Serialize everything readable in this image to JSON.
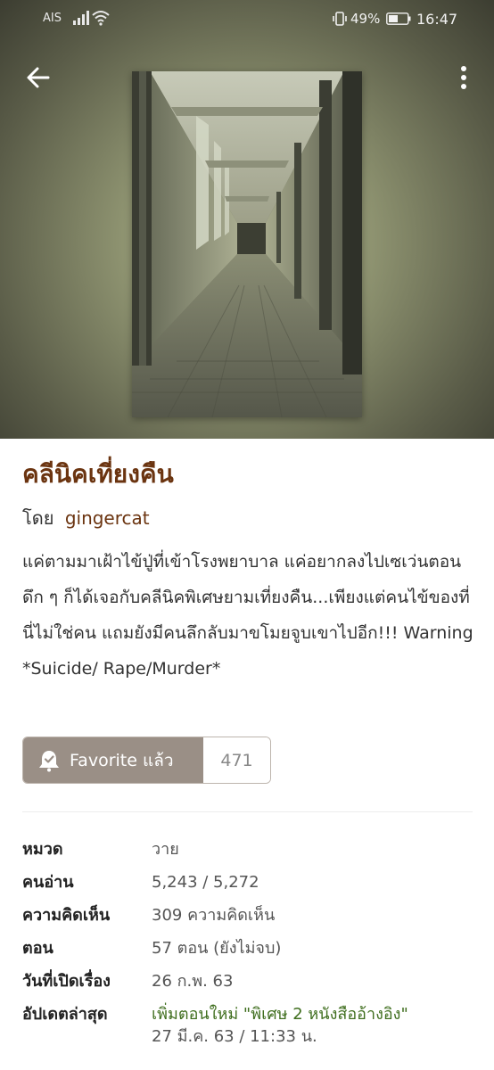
{
  "status_bar": {
    "carrier": "AIS",
    "battery_percent": "49%",
    "time": "16:47"
  },
  "icons": {
    "back": "back-arrow-icon",
    "more": "more-vertical-icon",
    "favorite": "bookmark-check-icon"
  },
  "colors": {
    "title": "#6b3410",
    "author": "#6b3410",
    "favorite_button": "#9a8f86",
    "latest_update": "#3f6e1e"
  },
  "story": {
    "title": "คลีนิคเที่ยงคืน",
    "author_prefix": "โดย",
    "author_name": "gingercat",
    "synopsis": "แค่ตามมาเฝ้าไข้ปู่ที่เข้าโรงพยาบาล แค่อยากลงไปเซเว่นตอนดึก ๆ ก็ได้เจอกับคลีนิคพิเศษยามเที่ยงคืน...เพียงแต่คนไข้ของที่นี่ไม่ใช่คน แถมยังมีคนลึกลับมาขโมยจูบเขาไปอีก!!! Warning *Suicide/ Rape/Murder*"
  },
  "favorite": {
    "label": "Favorite แล้ว",
    "count": "471"
  },
  "details": {
    "category_label": "หมวด",
    "category_value": "วาย",
    "readers_label": "คนอ่าน",
    "readers_value": "5,243 / 5,272",
    "comments_label": "ความคิดเห็น",
    "comments_value": "309 ความคิดเห็น",
    "chapters_label": "ตอน",
    "chapters_value": "57 ตอน (ยังไม่จบ)",
    "opened_label": "วันที่เปิดเรื่อง",
    "opened_value": "26 ก.พ. 63",
    "updated_label": "อัปเดตล่าสุด",
    "updated_value": "เพิ่มตอนใหม่ \"พิเศษ 2 หนังสืออ้างอิง\"",
    "updated_date": "27 มี.ค. 63 / 11:33 น."
  }
}
